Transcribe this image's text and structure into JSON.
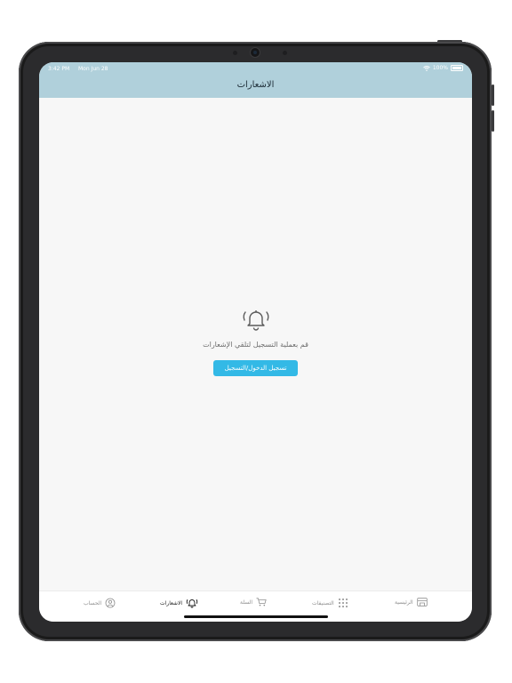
{
  "status_bar": {
    "time": "3:42 PM",
    "date": "Mon Jun 28",
    "battery": "100%"
  },
  "header": {
    "title": "الاشعارات"
  },
  "empty_state": {
    "icon": "bell-icon",
    "message": "قم بعملية التسجيل لتلقي الإشعارات",
    "button_label": "تسجيل الدخول/التسجيل"
  },
  "tabs": [
    {
      "label": "الرئيسية",
      "icon": "store-icon",
      "active": false
    },
    {
      "label": "التصنيفات",
      "icon": "grid-icon",
      "active": false
    },
    {
      "label": "السلة",
      "icon": "cart-icon",
      "active": false
    },
    {
      "label": "الاشعارات",
      "icon": "bell-icon",
      "active": true
    },
    {
      "label": "الحساب",
      "icon": "account-icon",
      "active": false
    }
  ],
  "colors": {
    "header_bg": "#b0d0db",
    "accent": "#33b9e6",
    "screen_bg": "#f7f7f7"
  }
}
